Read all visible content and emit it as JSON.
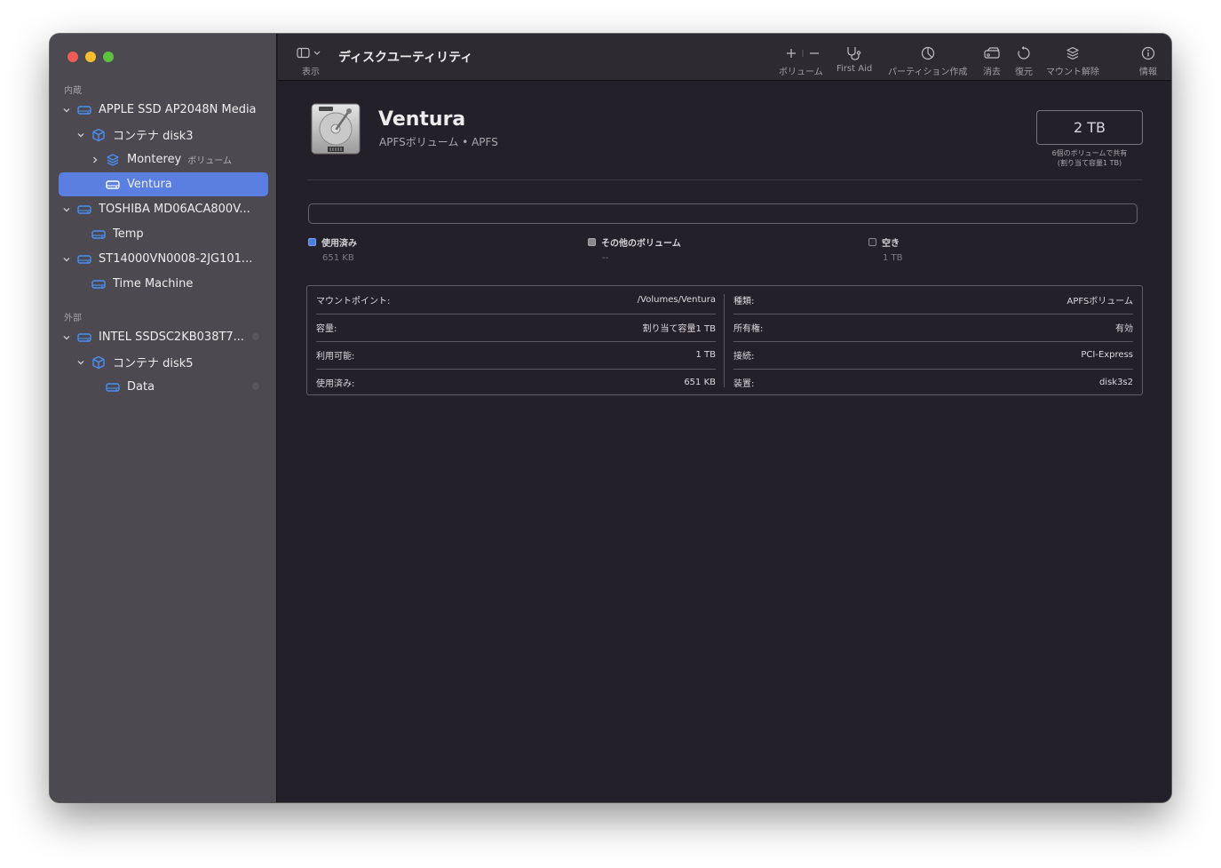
{
  "app": {
    "title": "ディスクユーティリティ"
  },
  "colors": {
    "sidebar": "#4c4a50",
    "main": "#242029",
    "accent_selection": "#5a7fe0",
    "drive_icon": "#4a90f7"
  },
  "toolbar": {
    "view_label": "表示",
    "items": [
      {
        "name": "volume",
        "label": "ボリューム",
        "icon": "plus-minus-icon"
      },
      {
        "name": "first-aid",
        "label": "First Aid",
        "icon": "stethoscope-icon"
      },
      {
        "name": "partition",
        "label": "パーティション作成",
        "icon": "pie-icon"
      },
      {
        "name": "erase",
        "label": "消去",
        "icon": "eraser-icon"
      },
      {
        "name": "restore",
        "label": "復元",
        "icon": "restore-icon"
      },
      {
        "name": "unmount",
        "label": "マウント解除",
        "icon": "layers-icon"
      },
      {
        "name": "info",
        "label": "情報",
        "icon": "info-icon"
      }
    ]
  },
  "sidebar": {
    "internal_label": "内蔵",
    "external_label": "外部",
    "items": [
      {
        "label": "APPLE SSD AP2048N Media",
        "icon": "drive-icon"
      },
      {
        "label": "コンテナ disk3",
        "icon": "container-icon"
      },
      {
        "label": "Monterey",
        "sublabel": "ボリューム",
        "icon": "volume-stack-icon"
      },
      {
        "label": "Ventura",
        "icon": "drive-icon",
        "selected": true
      },
      {
        "label": "TOSHIBA MD06ACA800V...",
        "icon": "drive-icon"
      },
      {
        "label": "Temp",
        "icon": "drive-icon"
      },
      {
        "label": "ST14000VN0008-2JG101...",
        "icon": "drive-icon"
      },
      {
        "label": "Time Machine",
        "icon": "drive-icon"
      },
      {
        "label": "INTEL SSDSC2KB038T7...",
        "icon": "drive-icon"
      },
      {
        "label": "コンテナ disk5",
        "icon": "container-icon"
      },
      {
        "label": "Data",
        "icon": "drive-icon"
      }
    ]
  },
  "volume": {
    "name": "Ventura",
    "subtitle": "APFSボリューム • APFS",
    "capacity": "2 TB",
    "capacity_note_line1": "6個のボリュームで共有",
    "capacity_note_line2": "(割り当て容量1 TB)"
  },
  "usage": {
    "used_fraction": 0.0,
    "legend": [
      {
        "label": "使用済み",
        "value": "651 KB",
        "color": "#4a7fe0"
      },
      {
        "label": "その他のボリューム",
        "value": "--",
        "color": "#8a888d"
      },
      {
        "label": "空き",
        "value": "1 TB",
        "color": "#2a2730"
      }
    ]
  },
  "info": {
    "left": [
      {
        "key": "マウントポイント:",
        "value": "/Volumes/Ventura"
      },
      {
        "key": "容量:",
        "value": "割り当て容量1 TB"
      },
      {
        "key": "利用可能:",
        "value": "1 TB"
      },
      {
        "key": "使用済み:",
        "value": "651 KB"
      }
    ],
    "right": [
      {
        "key": "種類:",
        "value": "APFSボリューム"
      },
      {
        "key": "所有権:",
        "value": "有効"
      },
      {
        "key": "接続:",
        "value": "PCI-Express"
      },
      {
        "key": "装置:",
        "value": "disk3s2"
      }
    ]
  }
}
